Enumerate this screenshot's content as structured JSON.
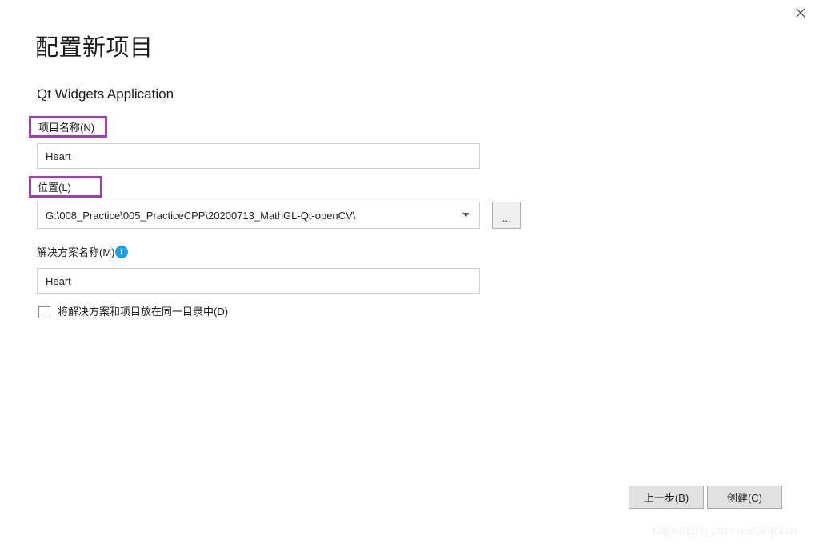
{
  "window": {
    "close_label": "×",
    "close_icon": "close-icon"
  },
  "header": {
    "title": "配置新项目",
    "template_name": "Qt Widgets Application"
  },
  "form": {
    "project_name": {
      "label": "项目名称(N)",
      "value": "Heart",
      "highlighted": true
    },
    "location": {
      "label": "位置(L)",
      "value": "G:\\008_Practice\\005_PracticeCPP\\20200713_MathGL-Qt-openCV\\",
      "highlighted": true,
      "dropdown_icon": "chevron-down-icon",
      "browse_label": "...",
      "browse_icon": "browse-ellipsis-icon"
    },
    "solution_name": {
      "label": "解决方案名称(M)",
      "value": "Heart",
      "info_icon": "info-icon",
      "info_glyph": "i"
    },
    "same_directory": {
      "label": "将解决方案和项目放在同一目录中(D)",
      "checked": false
    }
  },
  "footer": {
    "back_label": "上一步(B)",
    "create_label": "创建(C)"
  },
  "watermark": {
    "text": "https://blog.csdn.net/JinKairu"
  },
  "colors": {
    "highlight_purple": "#a23fb0",
    "info_blue": "#1ba1e2",
    "button_face": "#e1e1e1",
    "button_border": "#adadad",
    "input_border": "#cfcfcf",
    "background": "#ffffff",
    "text": "#1e1e1e",
    "watermark": "#f0f0f0"
  }
}
